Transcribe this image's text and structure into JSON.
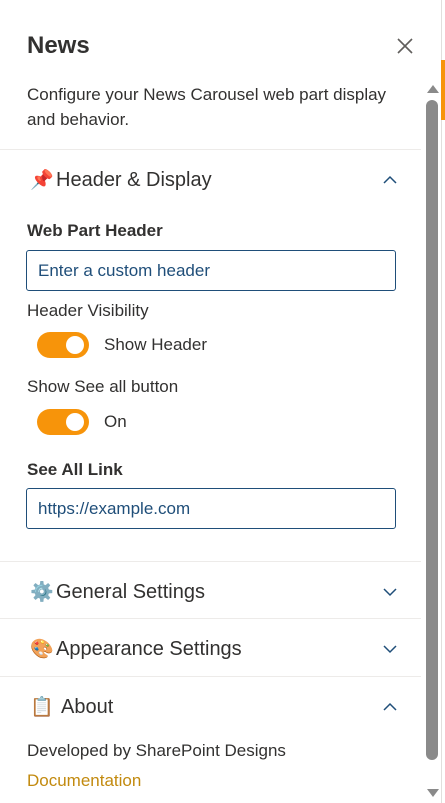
{
  "panel": {
    "title": "News",
    "description": "Configure your News Carousel web part display and behavior."
  },
  "sections": {
    "header_display": {
      "emoji": "📌",
      "label": "Header & Display",
      "expanded": true,
      "web_part_header_label": "Web Part Header",
      "web_part_header_placeholder": "Enter a custom header",
      "header_visibility_label": "Header Visibility",
      "header_visibility_toggle_text": "Show Header",
      "header_visibility_on": true,
      "see_all_button_label": "Show See all button",
      "see_all_button_toggle_text": "On",
      "see_all_button_on": true,
      "see_all_link_label": "See All Link",
      "see_all_link_value": "https://example.com"
    },
    "general": {
      "emoji": "⚙️",
      "label": "General Settings",
      "expanded": false
    },
    "appearance": {
      "emoji": "🎨",
      "label": "Appearance Settings",
      "expanded": false
    },
    "about": {
      "emoji": "📋",
      "label": "About",
      "expanded": true,
      "developed_by": "Developed by SharePoint Designs",
      "documentation_link": "Documentation"
    }
  },
  "colors": {
    "toggle_on": "#f7940a",
    "input_border": "#1f4e79",
    "link": "#c28a0f",
    "divider": "#edebe9"
  }
}
